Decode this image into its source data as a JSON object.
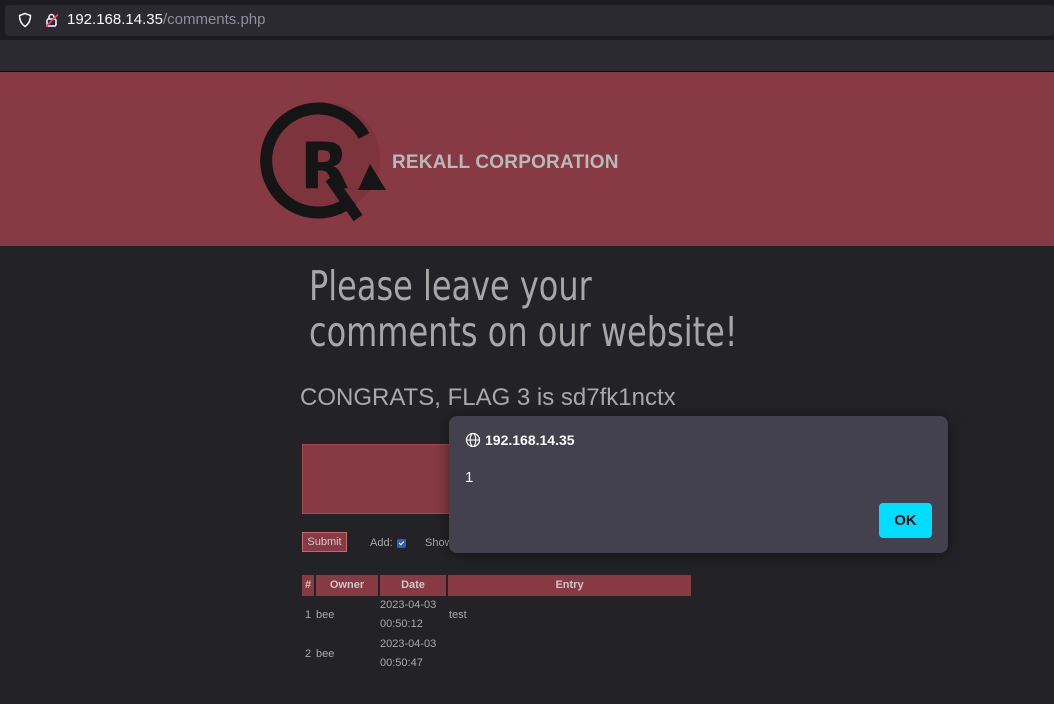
{
  "browser": {
    "url_host": "192.168.14.35",
    "url_path": "/comments.php"
  },
  "header": {
    "company_name": "REKALL CORPORATION",
    "logo_icon": "rekall-logo"
  },
  "main": {
    "heading_line1": "Please leave your",
    "heading_line2": "comments on our website!",
    "flag_message": "CONGRATS, FLAG 3 is sd7fk1nctx",
    "submit_label": "Submit",
    "add_label": "Add:",
    "show_label": "Show"
  },
  "table": {
    "columns": [
      "#",
      "Owner",
      "Date",
      "Entry"
    ],
    "rows": [
      {
        "num": "1",
        "owner": "bee",
        "date": "2023-04-03",
        "time": "00:50:12",
        "entry": "test"
      },
      {
        "num": "2",
        "owner": "bee",
        "date": "2023-04-03",
        "time": "00:50:47",
        "entry": ""
      }
    ]
  },
  "alert": {
    "host": "192.168.14.35",
    "message": "1",
    "ok_label": "OK"
  },
  "colors": {
    "brand": "#873a43",
    "dialog_bg": "#42414d",
    "ok_button": "#00ddff"
  }
}
